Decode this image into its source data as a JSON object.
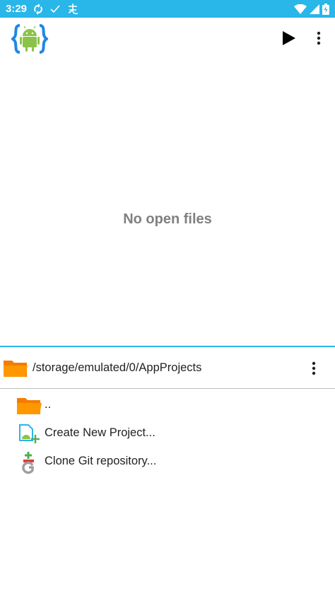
{
  "status_bar": {
    "time": "3:29",
    "icons": [
      "sync-icon",
      "check-icon",
      "input-method-icon",
      "wifi-icon",
      "cell-signal-icon",
      "battery-icon"
    ]
  },
  "app_bar": {
    "logo_icon": "android-braces-logo-icon",
    "run_icon": "play-icon",
    "menu_icon": "more-vert-icon"
  },
  "editor": {
    "empty_message": "No open files"
  },
  "file_browser": {
    "current_path": "/storage/emulated/0/AppProjects",
    "folder_icon": "folder-icon",
    "menu_icon": "more-vert-icon",
    "items": [
      {
        "label": "..",
        "icon": "folder-icon"
      },
      {
        "label": "Create New Project...",
        "icon": "new-project-icon"
      },
      {
        "label": "Clone Git repository...",
        "icon": "git-clone-icon"
      }
    ]
  },
  "colors": {
    "status_bar": "#29b6e8",
    "accent_line": "#29b6e8",
    "folder": "#ff9800",
    "empty_text": "#808080",
    "android_green": "#8bc34a"
  }
}
